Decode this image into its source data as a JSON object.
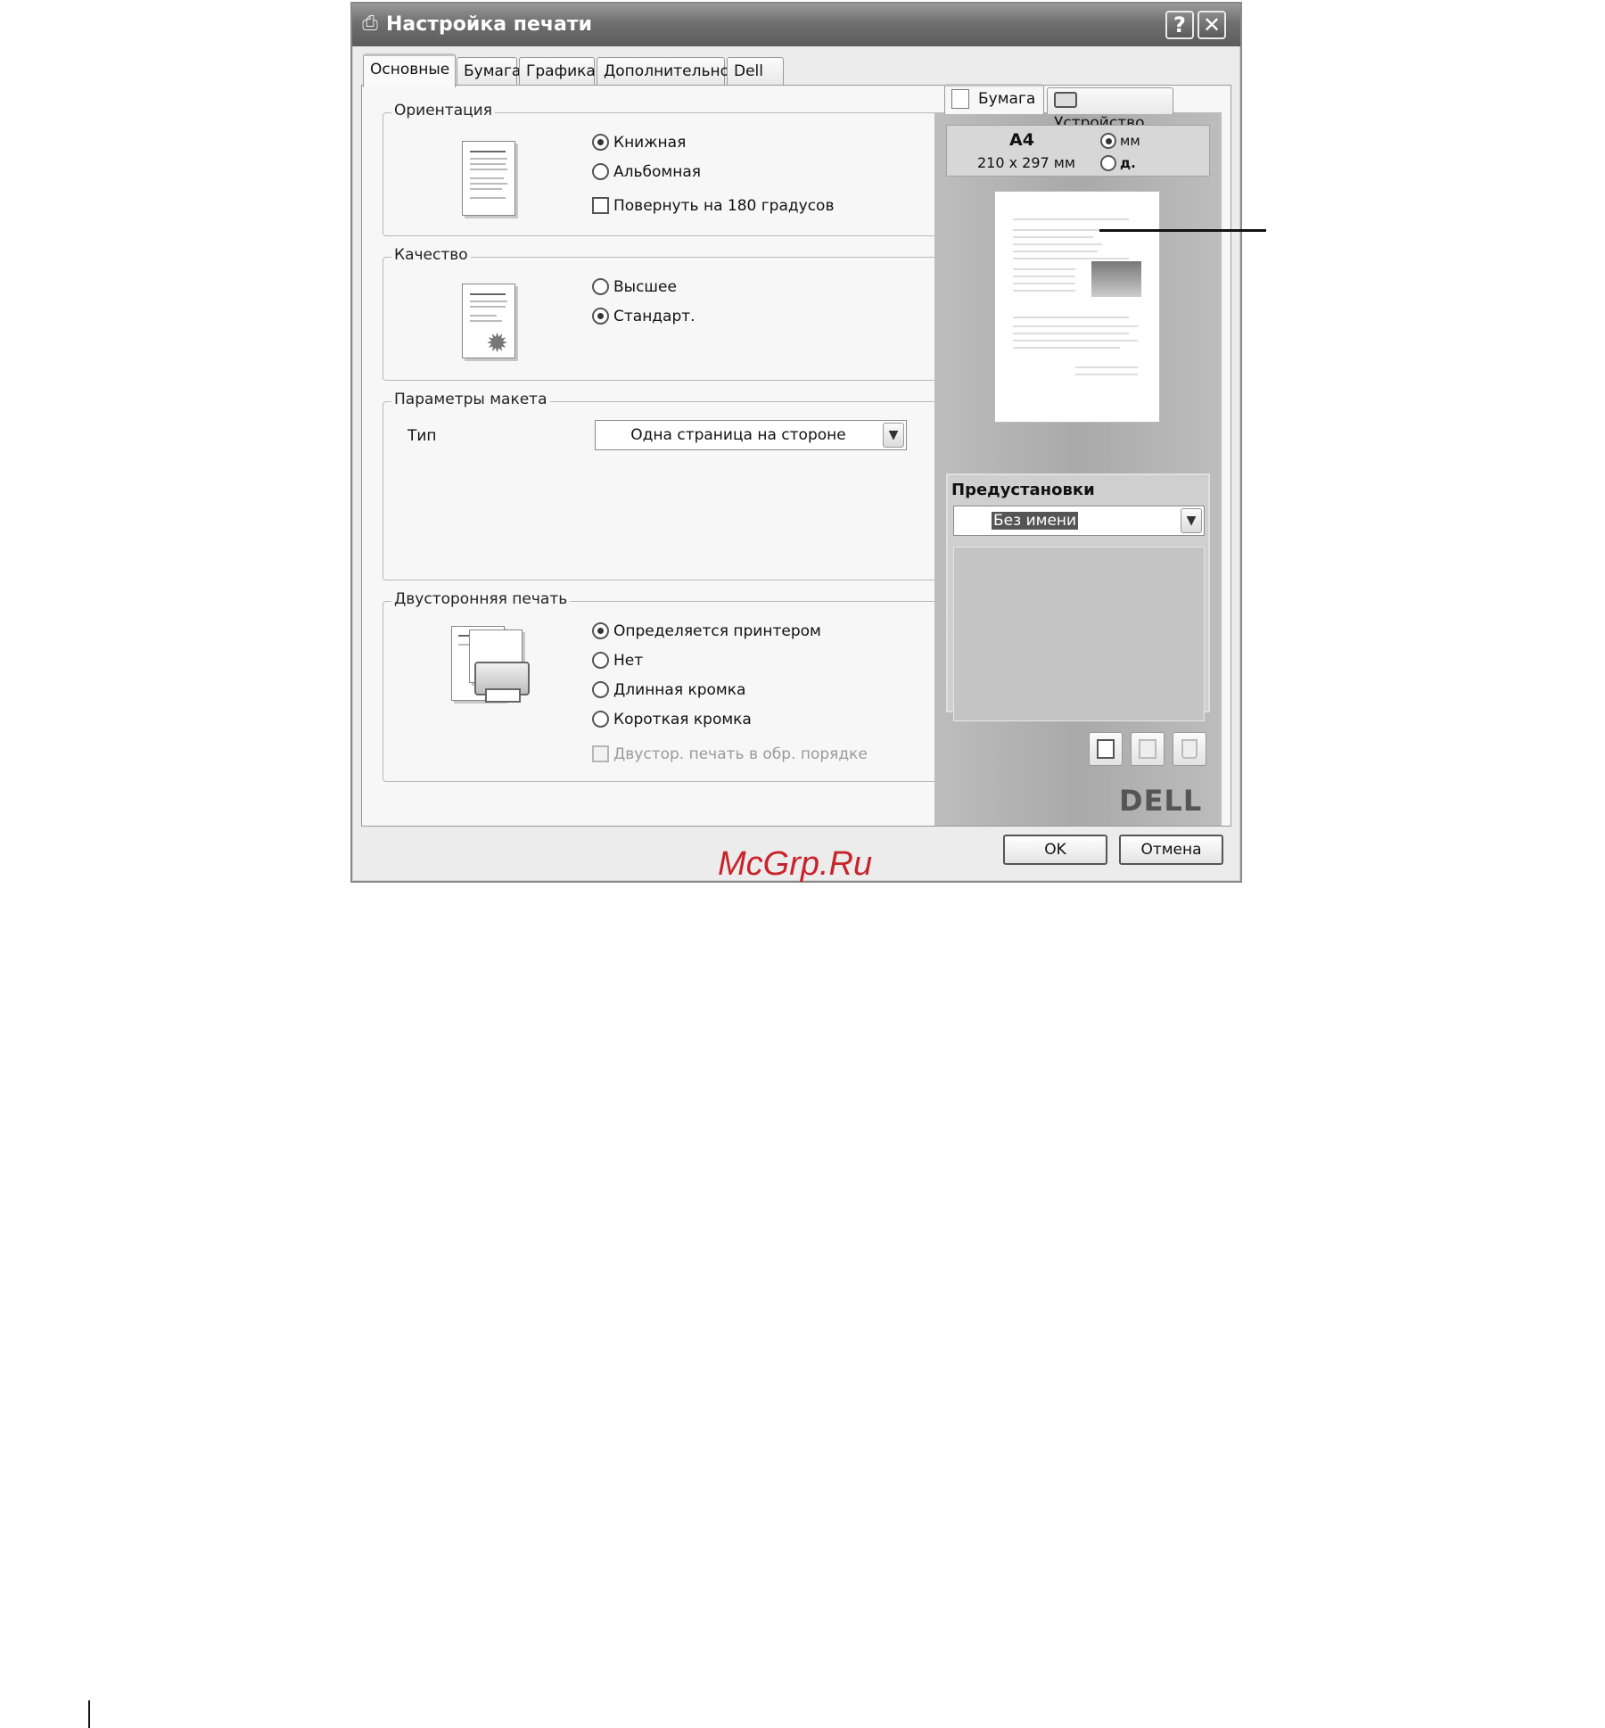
{
  "window": {
    "title": "Настройка печати",
    "help_label": "?",
    "close_label": "✕"
  },
  "tabs": [
    "Основные",
    "Бумага",
    "Графика",
    "Дополнительно",
    "Dell"
  ],
  "orientation": {
    "title": "Ориентация",
    "portrait": "Книжная",
    "landscape": "Альбомная",
    "rotate": "Повернуть на 180 градусов",
    "selected": "portrait",
    "rotate_checked": false
  },
  "quality": {
    "title": "Качество",
    "best": "Высшее",
    "standard": "Стандарт.",
    "selected": "standard"
  },
  "layout": {
    "title": "Параметры макета",
    "type_label": "Тип",
    "type_value": "Одна страница на стороне"
  },
  "duplex": {
    "title": "Двусторонняя печать",
    "printer_default": "Определяется принтером",
    "none": "Нет",
    "long_edge": "Длинная кромка",
    "short_edge": "Короткая кромка",
    "reverse": "Двустор. печать в обр. порядке",
    "selected": "printer_default"
  },
  "preview": {
    "tab_paper": "Бумага",
    "tab_device": "Устройство",
    "paper_size": "A4",
    "paper_dims": "210 x 297 мм",
    "unit_mm": "мм",
    "unit_in": "д.",
    "unit_selected": "mm"
  },
  "favorites": {
    "title": "Предустановки",
    "value": "Без имени"
  },
  "brand": "DELL",
  "buttons": {
    "ok": "OK",
    "cancel": "Отмена"
  },
  "watermark": "McGrp.Ru",
  "colors": {
    "watermark": "#c8242b",
    "titlebar": "#6f6f6f"
  }
}
